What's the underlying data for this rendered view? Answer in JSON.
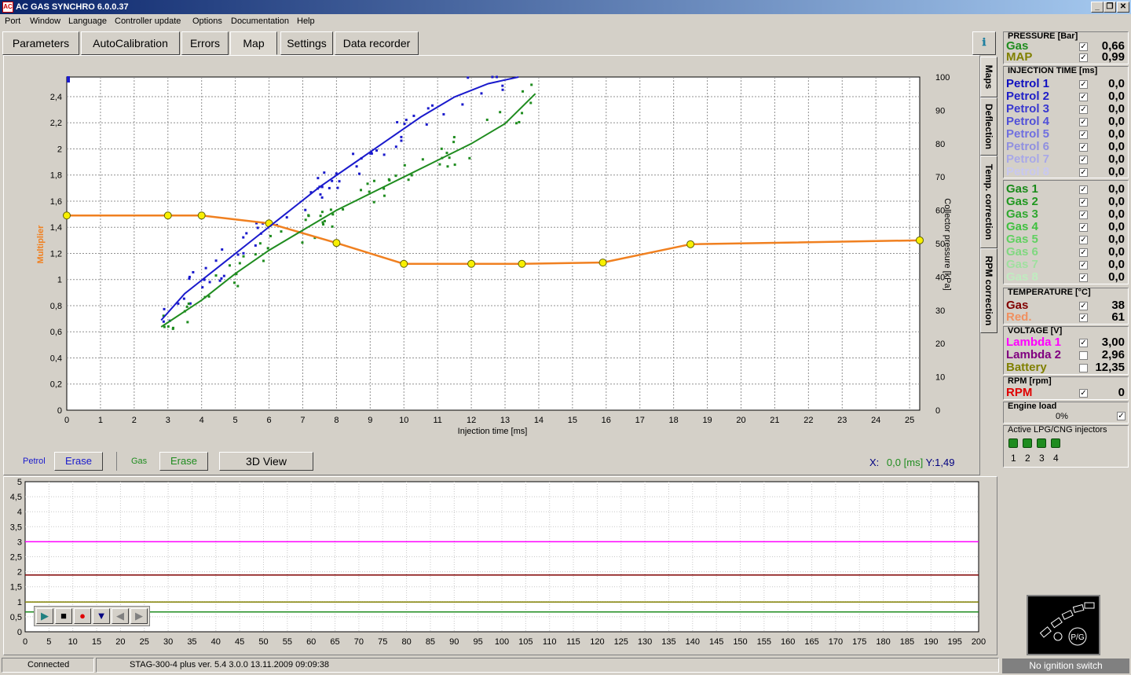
{
  "window": {
    "title": "AC GAS SYNCHRO  6.0.0.37",
    "icon_text": "AC",
    "minimize": "_",
    "restore": "❐",
    "close": "✕"
  },
  "menu": [
    "Port",
    "Window",
    "Language",
    "Controller update",
    "Options",
    "Documentation",
    "Help"
  ],
  "tabs": [
    "Parameters",
    "AutoCalibration",
    "Errors",
    "Map",
    "Settings",
    "Data recorder"
  ],
  "active_tab": "Map",
  "side_tabs": [
    "Maps",
    "Deflection",
    "Temp. correction",
    "RPM correction"
  ],
  "info_button_icon": "info-icon",
  "map_chart": {
    "ylabel_left": "Multiplier",
    "ylabel_right": "Collector pressure [kPa]",
    "xlabel": "Injection time [ms]",
    "x_ticks": [
      "0",
      "1",
      "2",
      "3",
      "4",
      "5",
      "6",
      "7",
      "8",
      "9",
      "10",
      "11",
      "12",
      "13",
      "14",
      "15",
      "16",
      "17",
      "18",
      "19",
      "20",
      "21",
      "22",
      "23",
      "24",
      "25"
    ],
    "y_left_ticks": [
      "0",
      "0,2",
      "0,4",
      "0,6",
      "0,8",
      "1",
      "1,2",
      "1,4",
      "1,6",
      "1,8",
      "2",
      "2,2",
      "2,4"
    ],
    "y_right_ticks": [
      "0",
      "10",
      "20",
      "30",
      "40",
      "50",
      "60",
      "70",
      "80",
      "90",
      "100"
    ],
    "colors": {
      "petrol": "#1a1acc",
      "gas": "#1f8c1f",
      "multiplier": "#f08020",
      "node": "#f8f000"
    }
  },
  "chart_data": [
    {
      "type": "line",
      "title": "",
      "xlabel": "Injection time [ms]",
      "ylabel": "Multiplier",
      "ylabel_right": "Collector pressure [kPa]",
      "xlim": [
        0,
        25.3
      ],
      "ylim": [
        0,
        2.55
      ],
      "ylim_right": [
        0,
        100
      ],
      "grid": true,
      "series": [
        {
          "name": "",
          "axis": "left",
          "color": "#f08020",
          "markers": true,
          "x": [
            0,
            3,
            4,
            6,
            8,
            10,
            12,
            13.5,
            15.9,
            18.5,
            25.3
          ],
          "y": [
            1.49,
            1.49,
            1.49,
            1.43,
            1.28,
            1.12,
            1.12,
            1.12,
            1.13,
            1.27,
            1.3
          ]
        },
        {
          "name": "Petrol",
          "axis": "right",
          "color": "#1a1acc",
          "x": [
            2.8,
            3.5,
            4.5,
            5.5,
            6.5,
            7.5,
            8.5,
            9.5,
            10.5,
            11.5,
            12.5,
            13.4
          ],
          "y": [
            27,
            35,
            43,
            51,
            59,
            67,
            74,
            81,
            88,
            94,
            98,
            100
          ]
        },
        {
          "name": "Gas",
          "axis": "right",
          "color": "#1f8c1f",
          "x": [
            2.8,
            4,
            5,
            6,
            7,
            8,
            9,
            10,
            11,
            12,
            13,
            13.9
          ],
          "y": [
            25,
            33,
            41,
            48,
            54,
            60,
            65,
            70,
            75,
            80,
            86,
            95
          ]
        }
      ]
    },
    {
      "type": "line",
      "title": "",
      "xlim": [
        0,
        200
      ],
      "ylim": [
        0,
        5
      ],
      "grid": true,
      "x_ticks": [
        "0",
        "5",
        "10",
        "15",
        "20",
        "25",
        "30",
        "35",
        "40",
        "45",
        "50",
        "55",
        "60",
        "65",
        "70",
        "75",
        "80",
        "85",
        "90",
        "95",
        "100",
        "105",
        "110",
        "115",
        "120",
        "125",
        "130",
        "135",
        "140",
        "145",
        "150",
        "155",
        "160",
        "165",
        "170",
        "175",
        "180",
        "185",
        "190",
        "195",
        "200"
      ],
      "y_ticks": [
        "0",
        "0,5",
        "1",
        "1,5",
        "2",
        "2,5",
        "3",
        "3,5",
        "4",
        "4,5",
        "5"
      ],
      "series": [
        {
          "name": "",
          "color": "#ff00ff",
          "x": [
            0,
            200
          ],
          "y": [
            3.0,
            3.0
          ]
        },
        {
          "name": "",
          "color": "#800000",
          "x": [
            0,
            200
          ],
          "y": [
            1.89,
            1.89
          ]
        },
        {
          "name": "",
          "color": "#808000",
          "x": [
            0,
            200
          ],
          "y": [
            0.99,
            0.99
          ]
        },
        {
          "name": "",
          "color": "#1f8c1f",
          "x": [
            0,
            200
          ],
          "y": [
            0.66,
            0.66
          ]
        }
      ]
    }
  ],
  "bottom_controls": {
    "petrol_label": "Petrol",
    "gas_label": "Gas",
    "erase": "Erase",
    "view3d": "3D View",
    "x_prefix": "X:",
    "x_value": "0,0",
    "x_unit": "[ms]",
    "y_prefix": "Y:",
    "y_value": "1,49"
  },
  "status": {
    "connection": "Connected",
    "device": "STAG-300-4 plus   ver. 5.4  3.0.0    13.11.2009 09:09:38"
  },
  "panel": {
    "pressure": {
      "title": "PRESSURE [Bar]",
      "rows": [
        {
          "label": "Gas",
          "value": "0,66",
          "checked": true,
          "color": "#1f8c1f"
        },
        {
          "label": "MAP",
          "value": "0,99",
          "checked": true,
          "color": "#808000"
        }
      ]
    },
    "injection": {
      "title": "INJECTION TIME [ms]",
      "rows": [
        {
          "label": "Petrol 1",
          "value": "0,0",
          "checked": true,
          "color": "#1010c0"
        },
        {
          "label": "Petrol 2",
          "value": "0,0",
          "checked": true,
          "color": "#2020c8"
        },
        {
          "label": "Petrol 3",
          "value": "0,0",
          "checked": true,
          "color": "#3838d0"
        },
        {
          "label": "Petrol 4",
          "value": "0,0",
          "checked": true,
          "color": "#5050d8"
        },
        {
          "label": "Petrol 5",
          "value": "0,0",
          "checked": true,
          "color": "#7070e0"
        },
        {
          "label": "Petrol 6",
          "value": "0,0",
          "checked": true,
          "color": "#9090e0"
        },
        {
          "label": "Petrol 7",
          "value": "0,0",
          "checked": true,
          "color": "#a8a8e8"
        },
        {
          "label": "Petrol 8",
          "value": "0,0",
          "checked": true,
          "color": "#c8c8f0"
        },
        {
          "label": "Gas 1",
          "value": "0,0",
          "checked": true,
          "color": "#1a8a1a"
        },
        {
          "label": "Gas 2",
          "value": "0,0",
          "checked": true,
          "color": "#209820"
        },
        {
          "label": "Gas 3",
          "value": "0,0",
          "checked": true,
          "color": "#30a830"
        },
        {
          "label": "Gas 4",
          "value": "0,0",
          "checked": true,
          "color": "#40c040"
        },
        {
          "label": "Gas 5",
          "value": "0,0",
          "checked": true,
          "color": "#60d060"
        },
        {
          "label": "Gas 6",
          "value": "0,0",
          "checked": true,
          "color": "#80d880"
        },
        {
          "label": "Gas 7",
          "value": "0,0",
          "checked": true,
          "color": "#a0e0a0"
        },
        {
          "label": "Gas 8",
          "value": "0,0",
          "checked": true,
          "color": "#c0ecc0"
        }
      ]
    },
    "temperature": {
      "title": "TEMPERATURE [°C]",
      "rows": [
        {
          "label": "Gas",
          "value": "38",
          "checked": true,
          "color": "#800000"
        },
        {
          "label": "Red.",
          "value": "61",
          "checked": true,
          "color": "#f09060"
        }
      ]
    },
    "voltage": {
      "title": "VOLTAGE [V]",
      "rows": [
        {
          "label": "Lambda 1",
          "value": "3,00",
          "checked": true,
          "color": "#ff00ff"
        },
        {
          "label": "Lambda 2",
          "value": "2,96",
          "checked": false,
          "color": "#800080"
        },
        {
          "label": "Battery",
          "value": "12,35",
          "checked": false,
          "color": "#808000"
        }
      ]
    },
    "rpm": {
      "title": "RPM [rpm]",
      "rows": [
        {
          "label": "RPM",
          "value": "0",
          "checked": true,
          "color": "#e00000"
        }
      ]
    },
    "engine_load": {
      "title": "Engine load",
      "value": "0%",
      "checked": true
    },
    "injectors": {
      "title": "Active LPG/CNG injectors",
      "items": [
        "1",
        "2",
        "3",
        "4"
      ]
    },
    "switch_label": "No ignition switch",
    "switch_text": "P/G"
  }
}
